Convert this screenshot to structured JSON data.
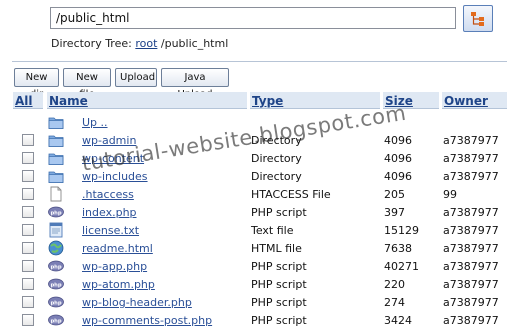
{
  "path": {
    "value": "/public_html"
  },
  "dirtree": {
    "label": "Directory Tree:",
    "root_link": "root",
    "current": "/public_html"
  },
  "toolbar": {
    "new_dir": "New dir",
    "new_file": "New file",
    "upload": "Upload",
    "java_upload": "Java Upload"
  },
  "columns": {
    "all": "All",
    "name": "Name",
    "type": "Type",
    "size": "Size",
    "owner": "Owner"
  },
  "watermark": "tutorial-website.blogspot.com",
  "files": [
    {
      "name": "Up ..",
      "type": "",
      "size": "",
      "owner": "",
      "icon": "folder-icon",
      "checkbox": false
    },
    {
      "name": "wp-admin",
      "type": "Directory",
      "size": "4096",
      "owner": "a7387977",
      "icon": "folder-icon",
      "checkbox": true
    },
    {
      "name": "wp-content",
      "type": "Directory",
      "size": "4096",
      "owner": "a7387977",
      "icon": "folder-icon",
      "checkbox": true
    },
    {
      "name": "wp-includes",
      "type": "Directory",
      "size": "4096",
      "owner": "a7387977",
      "icon": "folder-icon",
      "checkbox": true
    },
    {
      "name": ".htaccess",
      "type": "HTACCESS File",
      "size": "205",
      "owner": "99",
      "icon": "blank-file-icon",
      "checkbox": true
    },
    {
      "name": "index.php",
      "type": "PHP script",
      "size": "397",
      "owner": "a7387977",
      "icon": "php-icon",
      "checkbox": true
    },
    {
      "name": "license.txt",
      "type": "Text file",
      "size": "15129",
      "owner": "a7387977",
      "icon": "text-file-icon",
      "checkbox": true
    },
    {
      "name": "readme.html",
      "type": "HTML file",
      "size": "7638",
      "owner": "a7387977",
      "icon": "html-globe-icon",
      "checkbox": true
    },
    {
      "name": "wp-app.php",
      "type": "PHP script",
      "size": "40271",
      "owner": "a7387977",
      "icon": "php-icon",
      "checkbox": true
    },
    {
      "name": "wp-atom.php",
      "type": "PHP script",
      "size": "220",
      "owner": "a7387977",
      "icon": "php-icon",
      "checkbox": true
    },
    {
      "name": "wp-blog-header.php",
      "type": "PHP script",
      "size": "274",
      "owner": "a7387977",
      "icon": "php-icon",
      "checkbox": true
    },
    {
      "name": "wp-comments-post.php",
      "type": "PHP script",
      "size": "3424",
      "owner": "a7387977",
      "icon": "php-icon",
      "checkbox": true
    }
  ]
}
